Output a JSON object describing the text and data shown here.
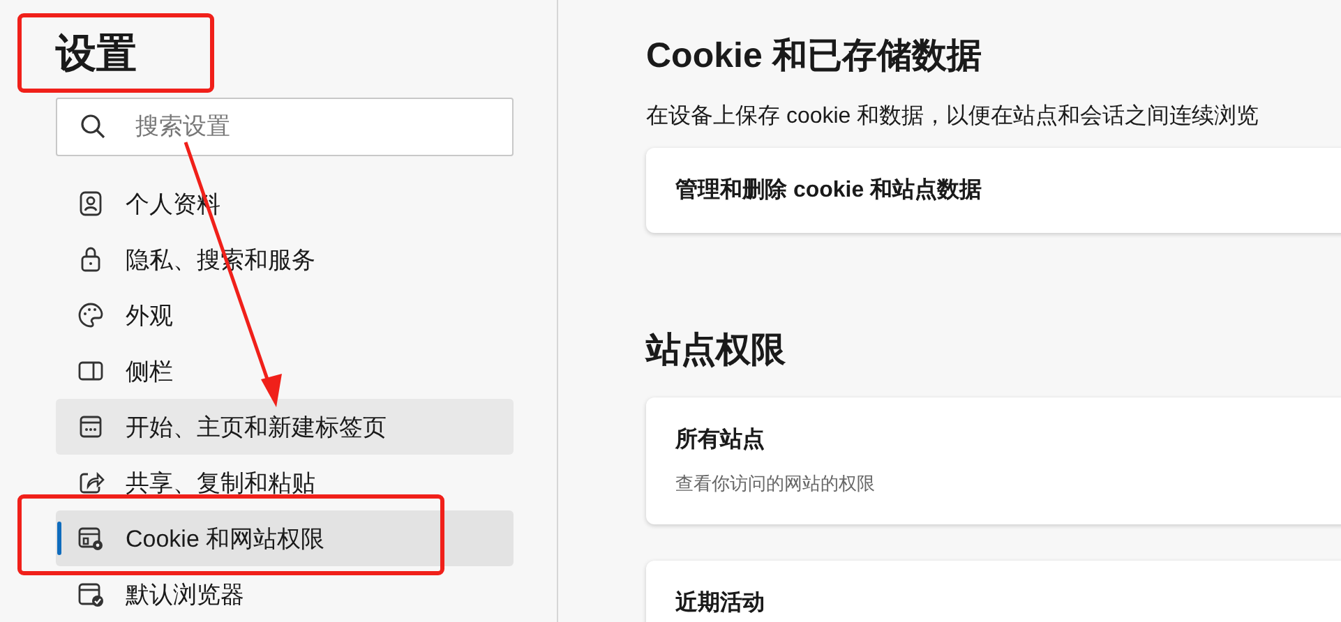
{
  "sidebar": {
    "title": "设置",
    "search": {
      "placeholder": "搜索设置"
    },
    "items": [
      {
        "label": "个人资料",
        "selected": false,
        "hovered": false
      },
      {
        "label": "隐私、搜索和服务",
        "selected": false,
        "hovered": false
      },
      {
        "label": "外观",
        "selected": false,
        "hovered": false
      },
      {
        "label": "侧栏",
        "selected": false,
        "hovered": false
      },
      {
        "label": "开始、主页和新建标签页",
        "selected": false,
        "hovered": true
      },
      {
        "label": "共享、复制和粘贴",
        "selected": false,
        "hovered": false
      },
      {
        "label": "Cookie 和网站权限",
        "selected": true,
        "hovered": false
      },
      {
        "label": "默认浏览器",
        "selected": false,
        "hovered": false
      }
    ]
  },
  "main": {
    "sections": [
      {
        "heading": "Cookie 和已存储数据",
        "description": "在设备上保存 cookie 和数据，以便在站点和会话之间连续浏览",
        "cards": [
          {
            "title": "管理和删除 cookie 和站点数据"
          }
        ]
      },
      {
        "heading": "站点权限",
        "cards": [
          {
            "title": "所有站点",
            "subtitle": "查看你访问的网站的权限"
          },
          {
            "title": "近期活动"
          }
        ]
      }
    ]
  }
}
